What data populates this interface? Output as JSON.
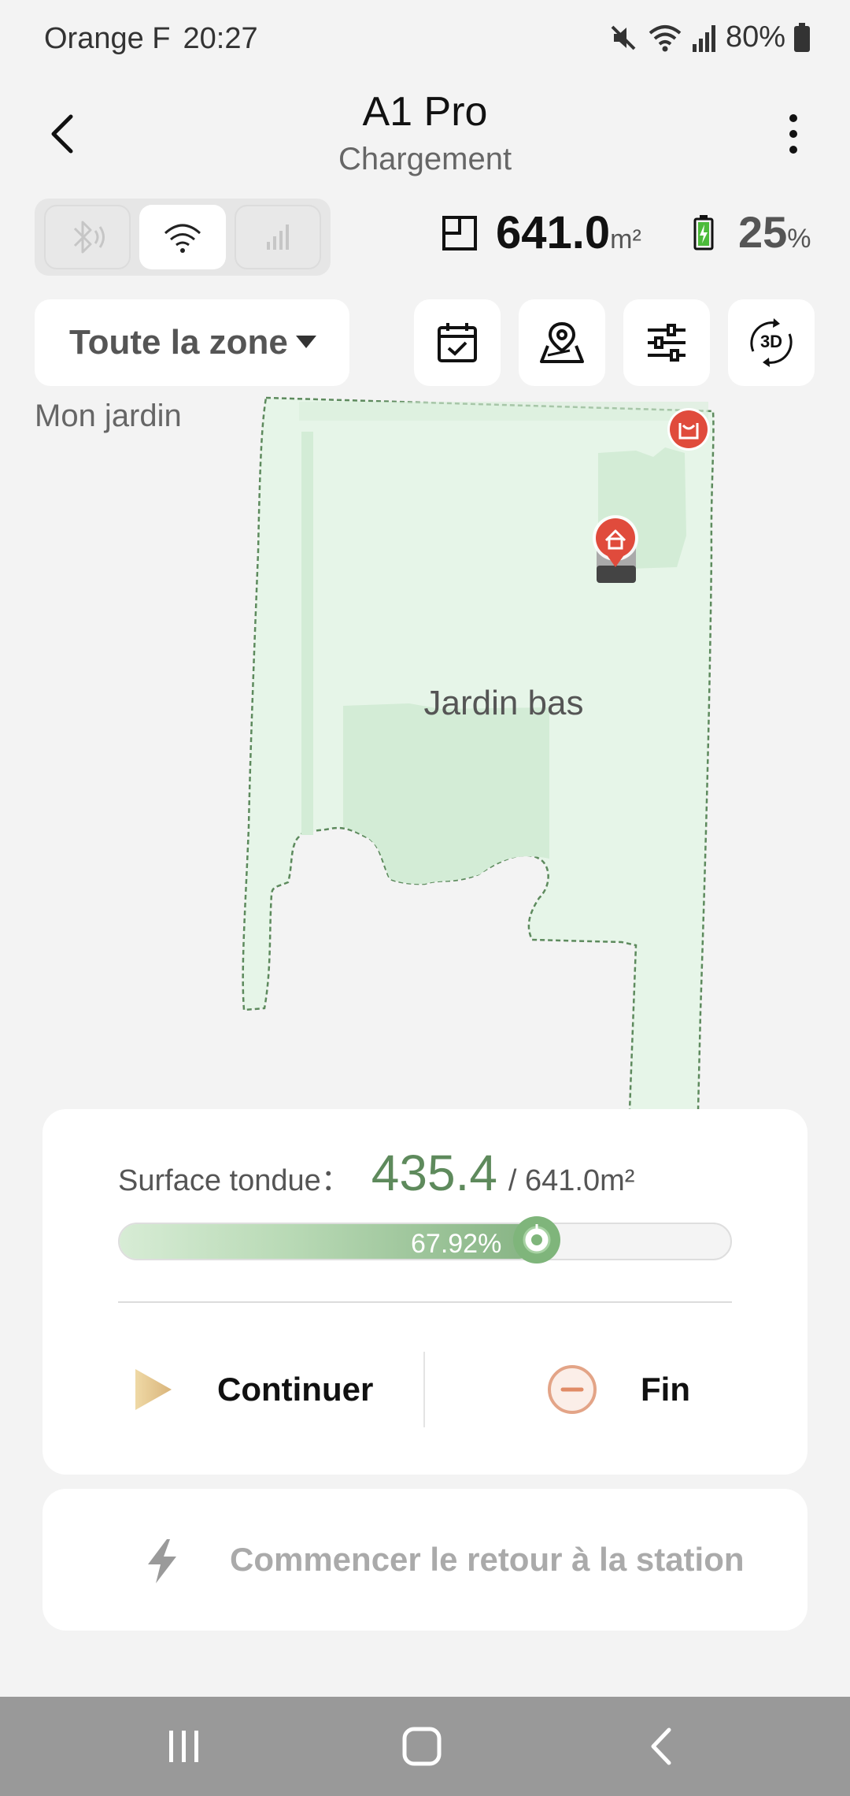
{
  "status_bar": {
    "carrier": "Orange F",
    "time": "20:27",
    "battery_percent": "80%"
  },
  "header": {
    "title": "A1 Pro",
    "subtitle": "Chargement"
  },
  "connection": {
    "active": "wifi",
    "options": [
      "bluetooth",
      "wifi",
      "cellular"
    ]
  },
  "stats": {
    "area_value": "641.0",
    "area_unit": "m²",
    "battery_value": "25",
    "battery_unit": "%"
  },
  "zone_selector": {
    "selected": "Toute la zone"
  },
  "toolbar": {
    "icons": [
      "schedule-icon",
      "map-edit-icon",
      "settings-sliders-icon",
      "3d-view-icon"
    ],
    "three_d_label": "3D"
  },
  "map": {
    "garden_name": "Mon jardin",
    "zone_name": "Jardin bas",
    "lawn_color": "#e6f5e8",
    "mowed_color": "#d3ecd6",
    "accent_red": "#e04b3c"
  },
  "mowing_card": {
    "label": "Surface tondue：",
    "mowed_value": "435.4",
    "total": "/ 641.0m²",
    "progress_percent": "67.92%",
    "progress_fraction": 0.6792,
    "continue_label": "Continuer",
    "end_label": "Fin"
  },
  "return_card": {
    "label": "Commencer le retour à la station"
  }
}
